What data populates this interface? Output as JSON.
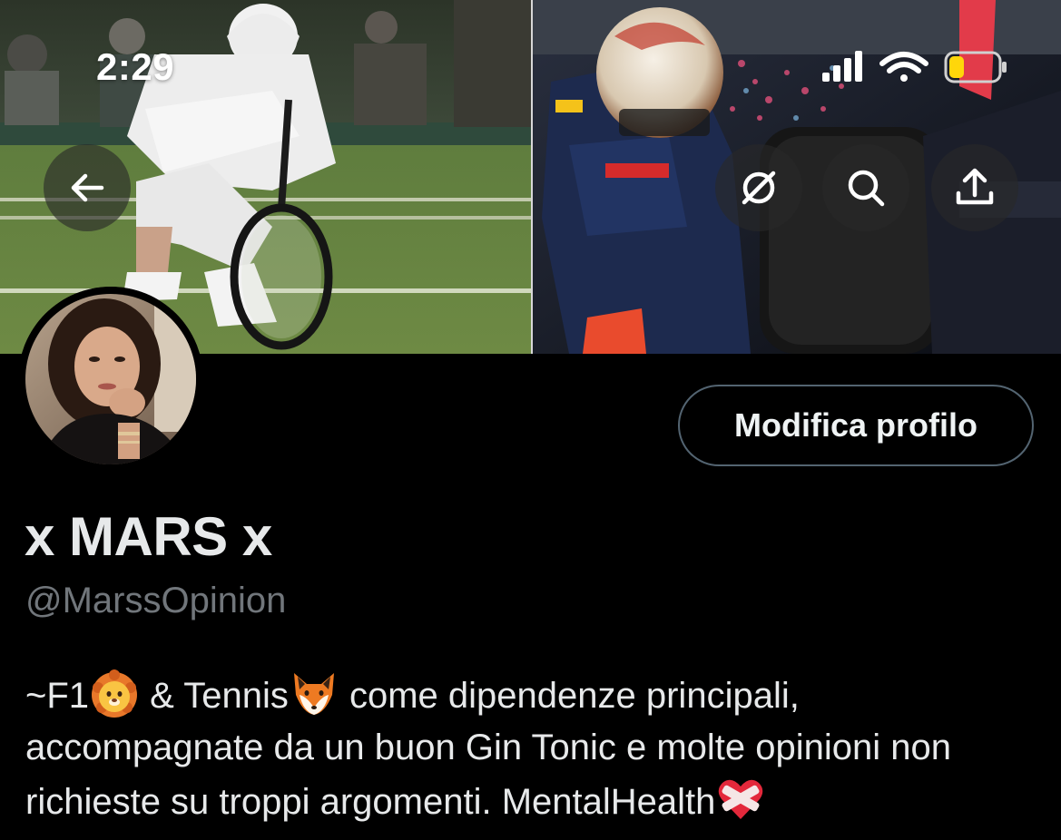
{
  "status_bar": {
    "time": "2:29"
  },
  "header_actions": {
    "back_icon": "arrow-left-icon",
    "grok_icon": "grok-slash-icon",
    "search_icon": "search-icon",
    "share_icon": "share-upload-icon"
  },
  "profile": {
    "edit_button_label": "Modifica profilo",
    "display_name": "x MARS x",
    "handle": "@MarssOpinion",
    "bio": {
      "part1": "~F1",
      "emoji1": "lion-face-emoji",
      "part2": " & Tennis",
      "emoji2": "fox-face-emoji",
      "part3": " come dipendenze principali, accompagnate da un buon Gin Tonic e molte opinioni non richieste su troppi argomenti. MentalHealth",
      "emoji3": "mending-heart-emoji"
    }
  },
  "colors": {
    "background": "#000000",
    "text_primary": "#e7e9ea",
    "text_secondary": "#71767b",
    "button_border": "#536471",
    "battery_fill": "#ffd60a"
  }
}
